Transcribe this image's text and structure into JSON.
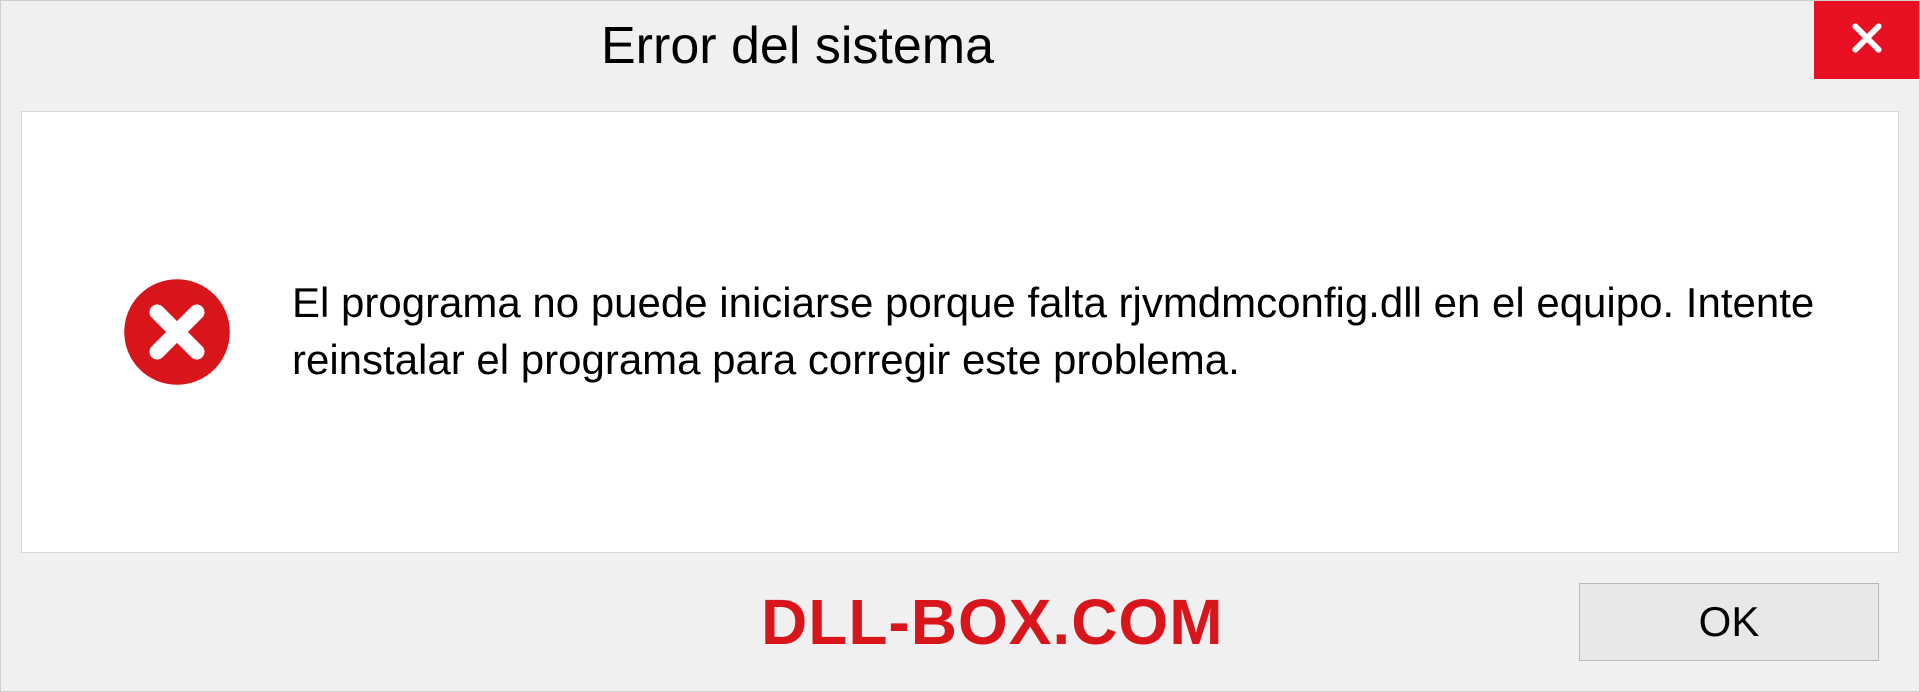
{
  "dialog": {
    "title": "Error del sistema",
    "message": "El programa no puede iniciarse porque falta rjvmdmconfig.dll en el equipo. Intente reinstalar el programa para corregir este problema.",
    "ok_label": "OK"
  },
  "watermark": "DLL-BOX.COM",
  "colors": {
    "close_bg": "#e81123",
    "error_icon": "#d8151a",
    "watermark": "#d8151a"
  }
}
